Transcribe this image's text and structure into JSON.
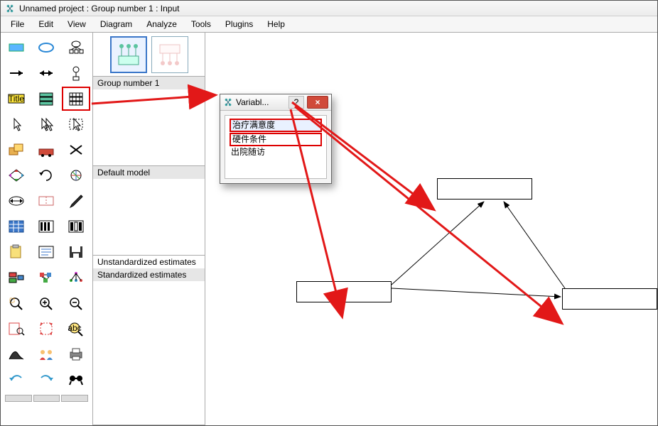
{
  "window": {
    "title": "Unnamed project : Group number 1 : Input"
  },
  "menus": {
    "file": "File",
    "edit": "Edit",
    "view": "View",
    "diagram": "Diagram",
    "analyze": "Analyze",
    "tools": "Tools",
    "plugins": "Plugins",
    "help": "Help"
  },
  "mid": {
    "group_label": "Group number 1",
    "default_model_label": "Default model",
    "unstd_label": "Unstandardized estimates",
    "std_label": "Standardized estimates"
  },
  "variables_dialog": {
    "title": "Variabl...",
    "help": "?",
    "close": "×",
    "items": [
      "治疗满意度",
      "硬件条件",
      "出院随访"
    ]
  },
  "icons": {
    "title": "Title"
  }
}
